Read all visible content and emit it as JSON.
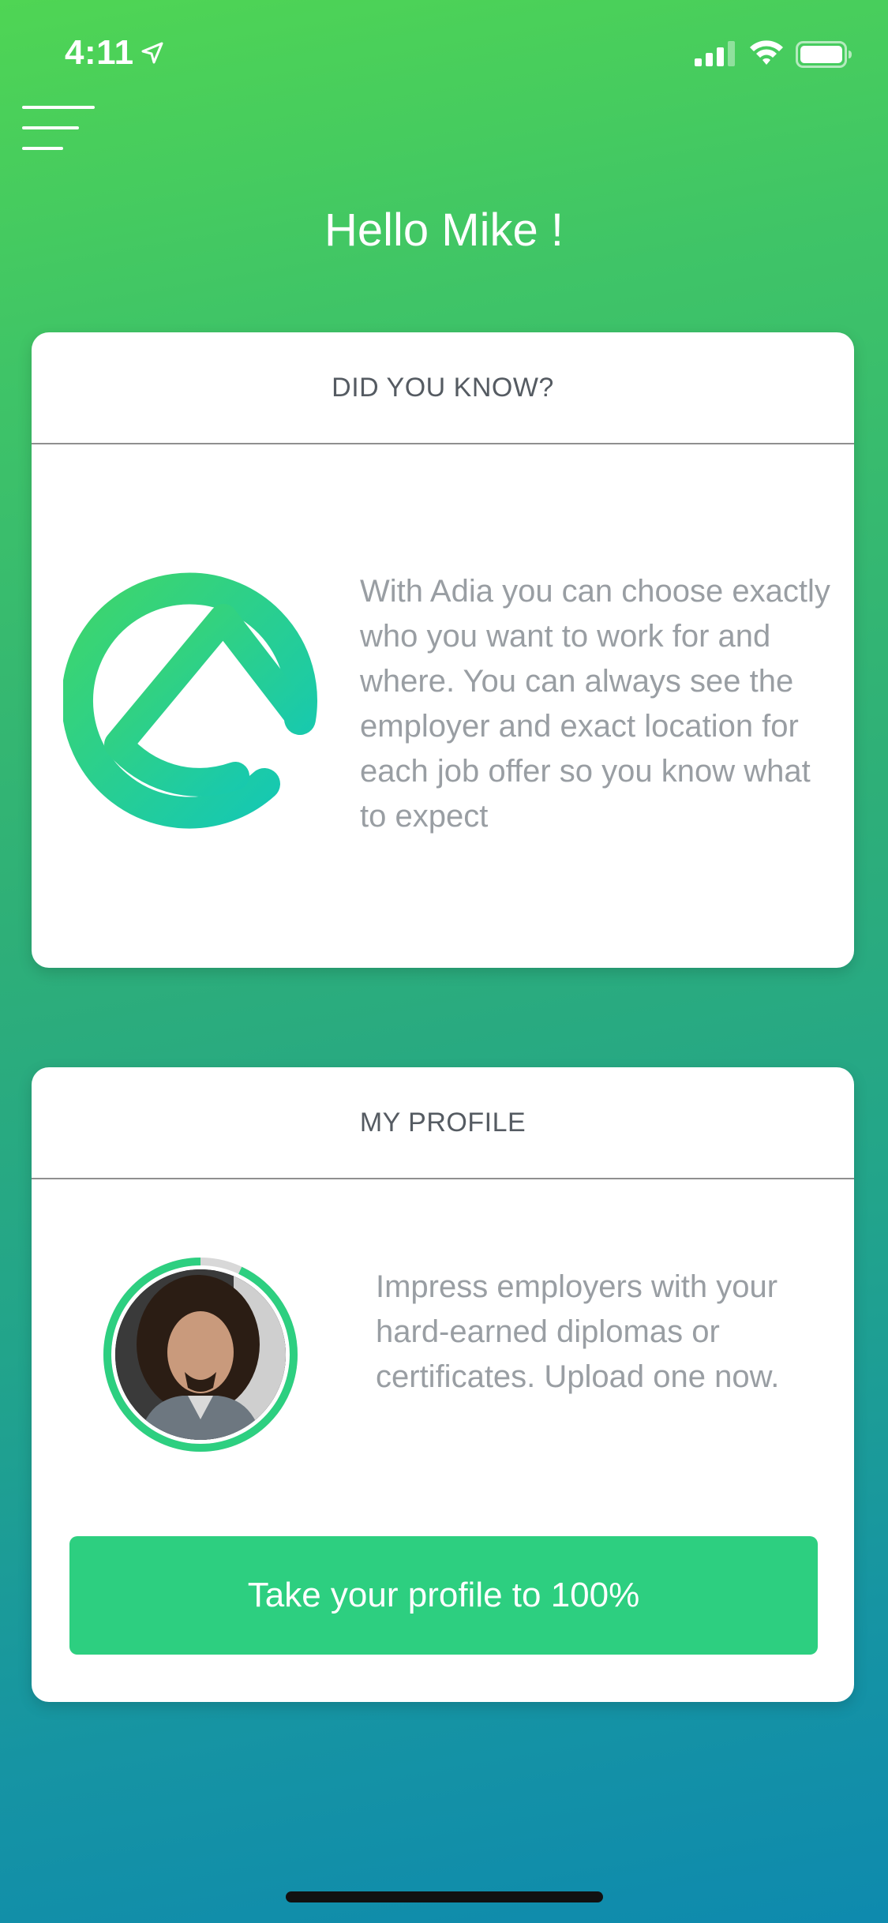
{
  "status_bar": {
    "time": "4:11",
    "icons": [
      "location-arrow-icon",
      "cellular-signal-icon",
      "wifi-icon",
      "battery-icon"
    ]
  },
  "menu": {
    "icon": "hamburger-menu-icon"
  },
  "greeting": "Hello Mike !",
  "did_you_know": {
    "title": "DID YOU KNOW?",
    "logo": "adia-logo",
    "text": "With Adia you can choose exactly who you want to work for and where. You can always see the employer and exact location for each job offer so you know what to expect"
  },
  "profile": {
    "title": "MY PROFILE",
    "avatar": "profile-photo",
    "completion_fraction": 0.93,
    "text": "Impress employers with your hard-earned diplomas or certificates. Upload one now.",
    "button_label": "Take your profile to 100%"
  },
  "colors": {
    "accent_green": "#2dcf80",
    "gradient_top": "#4fd554",
    "gradient_bottom": "#0e8aae",
    "text_gray": "#999ea3"
  }
}
